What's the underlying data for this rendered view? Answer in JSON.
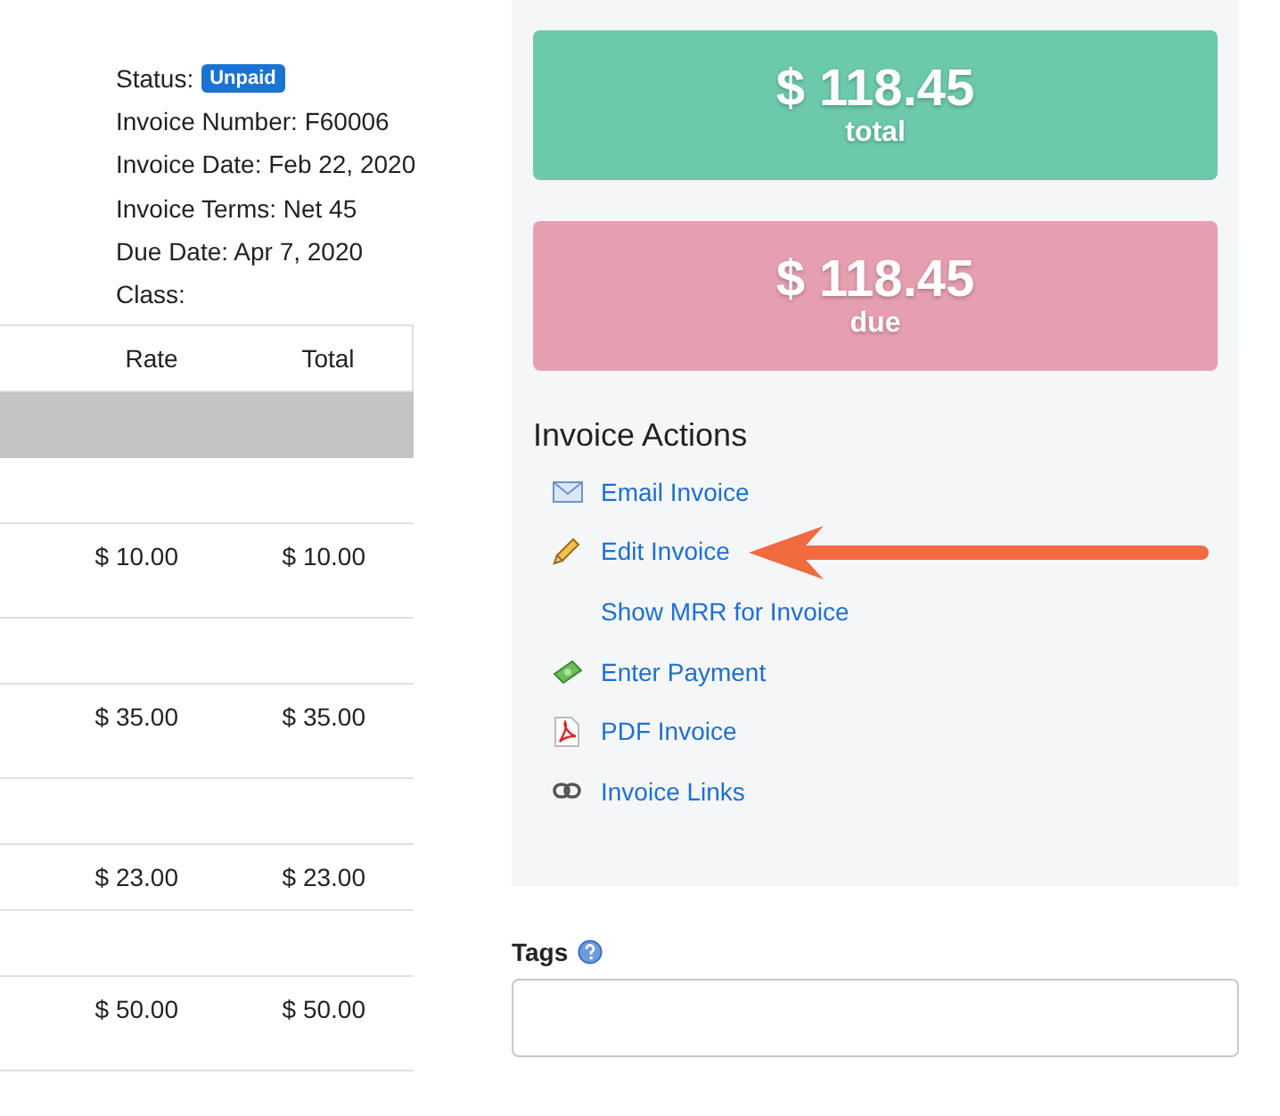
{
  "invoice_details": {
    "status_label": "Status:",
    "status": "Unpaid",
    "lines": [
      "Invoice Number: F60006",
      "Invoice Date: Feb 22, 2020",
      "Invoice Terms: Net 45",
      "Due Date: Apr 7, 2020",
      "Class:"
    ]
  },
  "table": {
    "columns": [
      "Rate",
      "Total"
    ],
    "rows": [
      {
        "kind": "detail",
        "rate": "$ 10.00",
        "total": "$ 10.00"
      },
      {
        "kind": "detail",
        "rate": "$ 35.00",
        "total": "$ 35.00"
      },
      {
        "kind": "detail",
        "rate": "$ 23.00",
        "total": "$ 23.00"
      },
      {
        "kind": "detail",
        "rate": "$ 50.00",
        "total": "$ 50.00"
      }
    ]
  },
  "summary_cards": [
    {
      "kind": "total",
      "amount": "$ 118.45",
      "label": "total"
    },
    {
      "kind": "due",
      "amount": "$ 118.45",
      "label": "due"
    }
  ],
  "invoice_actions": {
    "title": "Invoice Actions",
    "items": [
      {
        "kind": "email",
        "label": "Email Invoice",
        "highlighted": false
      },
      {
        "kind": "edit",
        "label": "Edit Invoice",
        "highlighted": true
      },
      {
        "kind": "mrr",
        "label": "Show MRR for Invoice",
        "highlighted": false
      },
      {
        "kind": "payment",
        "label": "Enter Payment",
        "highlighted": false
      },
      {
        "kind": "pdf",
        "label": "PDF Invoice",
        "highlighted": false
      },
      {
        "kind": "links",
        "label": "Invoice Links",
        "highlighted": false
      }
    ]
  },
  "tags": {
    "label": "Tags"
  }
}
